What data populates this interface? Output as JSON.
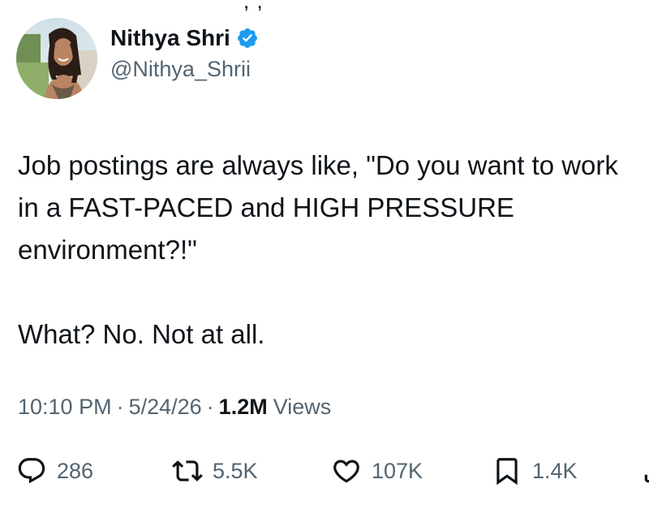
{
  "author": {
    "display_name": "Nithya Shri",
    "handle": "@Nithya_Shrii",
    "verified": true
  },
  "tweet": {
    "paragraphs": [
      "Job postings are always like, \"Do you want to work in a FAST-PACED and HIGH PRESSURE environment?!\"",
      "What? No. Not at all."
    ]
  },
  "meta": {
    "time": "10:10 PM",
    "separator": "·",
    "date": "5/24/26",
    "views_count": "1.2M",
    "views_label": "Views"
  },
  "actions": {
    "replies": "286",
    "reposts": "5.5K",
    "likes": "107K",
    "bookmarks": "1.4K"
  },
  "icons": {
    "reply": "speech-bubble-icon",
    "repost": "repost-arrows-icon",
    "like": "heart-icon",
    "bookmark": "bookmark-icon",
    "share": "share-icon",
    "verified": "verified-badge-icon"
  },
  "colors": {
    "text_primary": "#0f1419",
    "text_secondary": "#536471",
    "verified_blue": "#1d9bf0",
    "background": "#ffffff"
  }
}
